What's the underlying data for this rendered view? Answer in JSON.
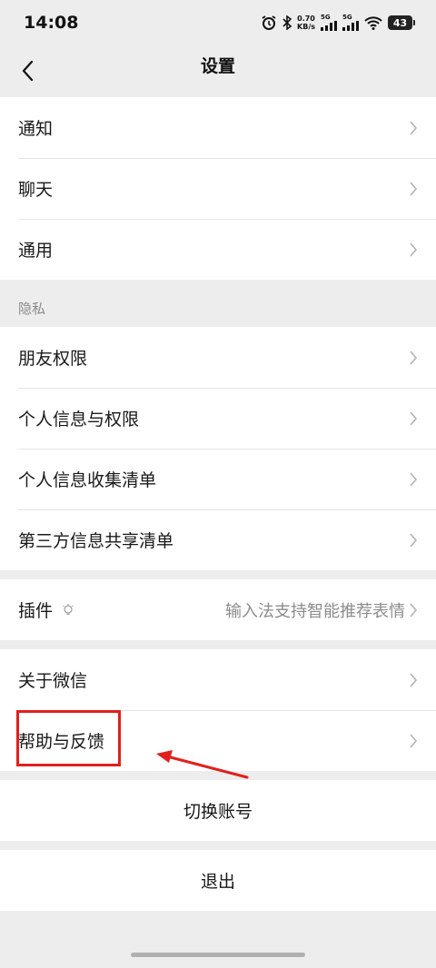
{
  "status_bar": {
    "time": "14:08",
    "net_speed_value": "0.70",
    "net_speed_unit": "KB/s",
    "signal_1_label": "5G",
    "signal_2_label": "5G",
    "battery": "43",
    "icons": [
      "alarm-icon",
      "bluetooth-icon",
      "signal-icon",
      "signal-icon",
      "wifi-icon",
      "battery-icon"
    ]
  },
  "header": {
    "title": "设置",
    "back_icon": "chevron-left-icon"
  },
  "group_main": {
    "items": [
      {
        "label": "通知"
      },
      {
        "label": "聊天"
      },
      {
        "label": "通用"
      }
    ]
  },
  "section_privacy": {
    "label": "隐私",
    "items": [
      {
        "label": "朋友权限"
      },
      {
        "label": "个人信息与权限"
      },
      {
        "label": "个人信息收集清单"
      },
      {
        "label": "第三方信息共享清单"
      }
    ]
  },
  "group_plugins": {
    "label": "插件",
    "icon": "bulb-icon",
    "value": "输入法支持智能推荐表情"
  },
  "group_about": {
    "items": [
      {
        "label": "关于微信"
      },
      {
        "label": "帮助与反馈"
      }
    ]
  },
  "actions": {
    "switch_account": "切换账号",
    "logout": "退出"
  },
  "annotation": {
    "highlight_color": "#e0201d",
    "highlighted_item": "帮助与反馈"
  },
  "colors": {
    "background": "#ededed",
    "card": "#ffffff",
    "text": "#191919",
    "secondary_text": "#8c8c8c"
  }
}
